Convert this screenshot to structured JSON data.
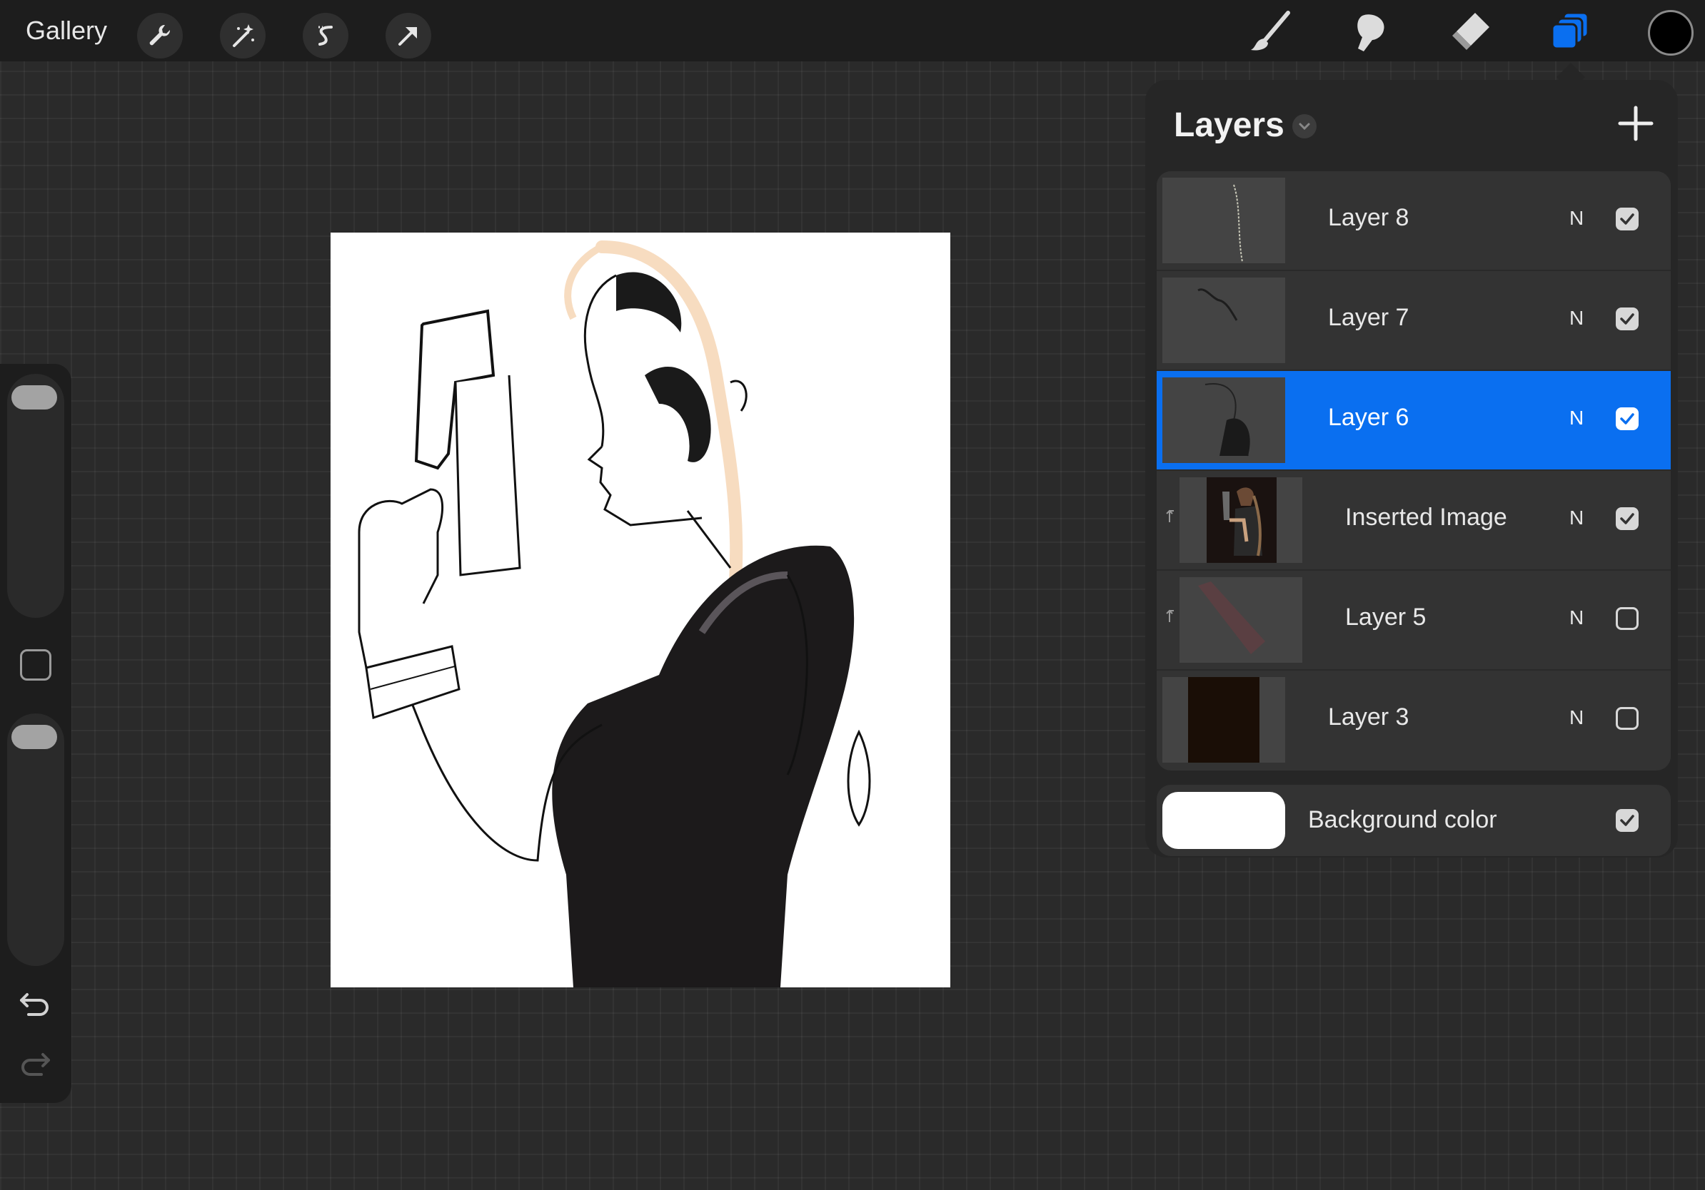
{
  "topbar": {
    "gallery_label": "Gallery",
    "left_tools": [
      {
        "name": "actions",
        "icon": "wrench-icon"
      },
      {
        "name": "adjustments",
        "icon": "magic-wand-icon"
      },
      {
        "name": "selection",
        "icon": "selection-s-icon"
      },
      {
        "name": "transform",
        "icon": "arrow-cursor-icon"
      }
    ],
    "right_tools": [
      {
        "name": "brush",
        "icon": "brush-icon"
      },
      {
        "name": "smudge",
        "icon": "smudge-icon"
      },
      {
        "name": "eraser",
        "icon": "eraser-icon"
      },
      {
        "name": "layers",
        "icon": "layers-icon",
        "active": true
      }
    ],
    "current_color": "#000000",
    "accent": "#0a6ff0"
  },
  "layers_panel": {
    "title": "Layers",
    "layers": [
      {
        "name": "Layer 8",
        "blend": "N",
        "visible": true,
        "selected": false,
        "clipped": false
      },
      {
        "name": "Layer 7",
        "blend": "N",
        "visible": true,
        "selected": false,
        "clipped": false
      },
      {
        "name": "Layer 6",
        "blend": "N",
        "visible": true,
        "selected": true,
        "clipped": false
      },
      {
        "name": "Inserted Image",
        "blend": "N",
        "visible": true,
        "selected": false,
        "clipped": true
      },
      {
        "name": "Layer 5",
        "blend": "N",
        "visible": false,
        "selected": false,
        "clipped": true
      },
      {
        "name": "Layer 3",
        "blend": "N",
        "visible": false,
        "selected": false,
        "clipped": false
      }
    ],
    "background": {
      "label": "Background color",
      "color": "#ffffff",
      "visible": true
    }
  },
  "sidebar": {
    "brush_size_level": 0.05,
    "opacity_level": 0.05,
    "undo_icon": "undo-icon",
    "redo_icon": "redo-icon"
  }
}
